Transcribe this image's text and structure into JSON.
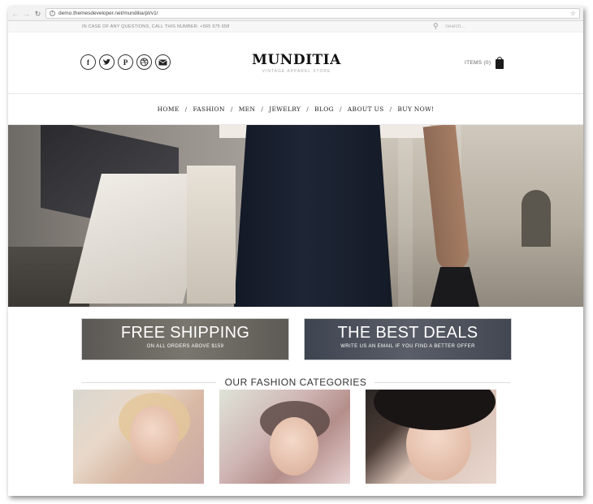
{
  "browser": {
    "url": "demo.themesdeveloper.net/munditia/pt/v1/"
  },
  "topbar": {
    "phone_text": "IN CASE OF ANY QUESTIONS, CALL THIS NUMBER: +565 975 658",
    "search_placeholder": "Search..."
  },
  "header": {
    "logo": "MUNDITIA",
    "tagline": "VINTAGE APPAREL STORE",
    "cart_label": "ITEMS (0)",
    "social_icons": [
      "facebook-icon",
      "twitter-icon",
      "pinterest-icon",
      "dribbble-icon",
      "mail-icon"
    ]
  },
  "nav": {
    "items": [
      "HOME",
      "FASHION",
      "MEN",
      "JEWELRY",
      "BLOG",
      "ABOUT US",
      "BUY NOW!"
    ],
    "separator": "/"
  },
  "promos": {
    "left": {
      "title": "FREE SHIPPING",
      "subtitle": "ON ALL ORDERS ABOVE $159"
    },
    "right": {
      "title": "THE BEST DEALS",
      "subtitle": "WRITE US AN EMAIL IF YOU FIND A BETTER OFFER"
    }
  },
  "categories": {
    "heading": "OUR FASHION CATEGORIES"
  }
}
